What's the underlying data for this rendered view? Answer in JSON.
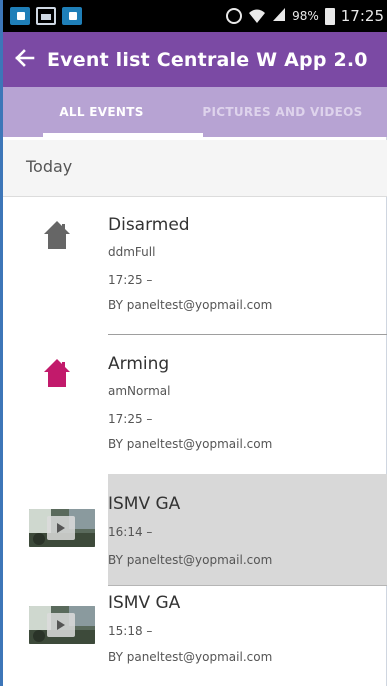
{
  "status_bar": {
    "battery": "98%",
    "time": "17:25",
    "icons": [
      "app-notification-icon",
      "gallery-notification-icon",
      "app-notification-icon",
      "alarm-icon",
      "wifi-icon",
      "signal-icon",
      "battery-icon"
    ]
  },
  "app_bar": {
    "back_icon": "arrow-left-icon",
    "title": "Event list Centrale W App 2.0",
    "color": "#7b4aa4"
  },
  "tabs": [
    {
      "label": "ALL EVENTS",
      "active": true
    },
    {
      "label": "PICTURES AND VIDEOS",
      "active": false
    }
  ],
  "section": {
    "label": "Today"
  },
  "events": [
    {
      "name": "Disarmed",
      "detail": "ddmFull",
      "time": "17:25 –",
      "by": "BY paneltest@yopmail.com",
      "icon": "house-icon",
      "icon_color": "#666666"
    },
    {
      "name": "Arming",
      "detail": "amNormal",
      "time": "17:25 –",
      "by": "BY paneltest@yopmail.com",
      "icon": "house-icon",
      "icon_color": "#c21a6b"
    },
    {
      "name": "ISMV GA",
      "time": "16:14 –",
      "by": "BY paneltest@yopmail.com",
      "icon": "video-thumbnail",
      "selected": true
    },
    {
      "name": "ISMV GA",
      "time": "15:18 –",
      "by": "BY paneltest@yopmail.com",
      "icon": "video-thumbnail",
      "selected": false
    }
  ]
}
